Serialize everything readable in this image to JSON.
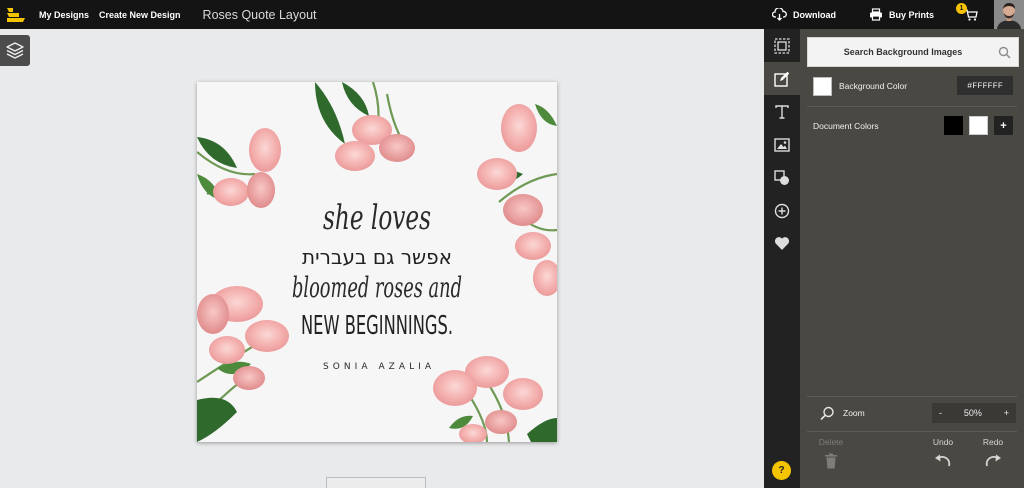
{
  "header": {
    "nav": [
      "My Designs",
      "Create New Design"
    ],
    "document_title": "Roses Quote Layout",
    "download_label": "Download",
    "buy_prints_label": "Buy Prints",
    "cart_count": "1"
  },
  "design": {
    "line1": "she loves",
    "line2": "אפשר גם בעברית",
    "line3": "bloomed roses and",
    "line4": "NEW BEGINNINGS.",
    "author": "SONIA AZALIA"
  },
  "panel": {
    "search_placeholder": "Search Background Images",
    "background_color_label": "Background Color",
    "background_color_value": "#FFFFFF",
    "document_colors_label": "Document Colors",
    "document_colors": [
      "#000000",
      "#FFFFFF"
    ],
    "add_color_label": "+",
    "zoom_label": "Zoom",
    "zoom_minus": "-",
    "zoom_value": "50%",
    "zoom_plus": "+",
    "delete_label": "Delete",
    "undo_label": "Undo",
    "redo_label": "Redo"
  },
  "rail": {
    "help_label": "?"
  },
  "colors": {
    "accent": "#F5C400",
    "topbar": "#141414",
    "panel": "#4A4843",
    "rail": "#222222"
  }
}
